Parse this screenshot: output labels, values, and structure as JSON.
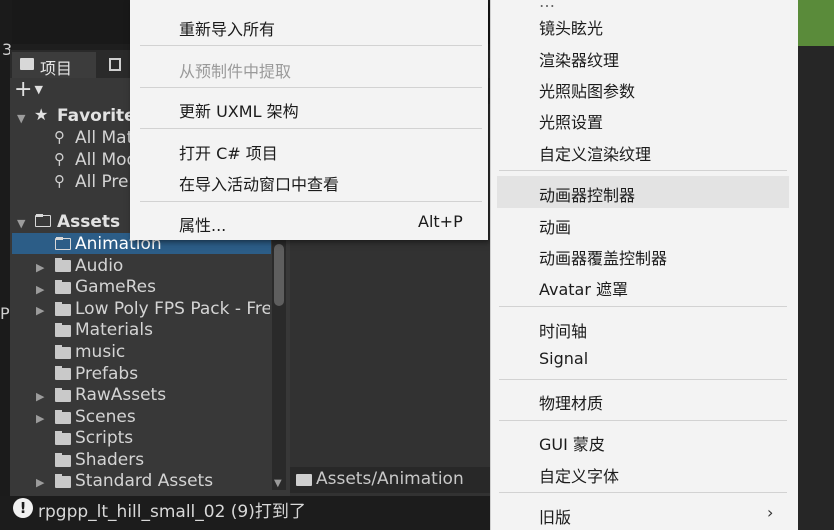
{
  "edge": {
    "num_top": "3",
    "num_mid": "P"
  },
  "project_panel": {
    "tab_label": "项目",
    "add_label": "+",
    "favorites": {
      "label": "Favorites",
      "items": [
        "All Mat",
        "All Mod",
        "All Pre"
      ]
    },
    "assets": {
      "label": "Assets",
      "folders": [
        "Animation",
        "Audio",
        "GameRes",
        "Low Poly FPS Pack - Free",
        "Materials",
        "music",
        "Prefabs",
        "RawAssets",
        "Scenes",
        "Scripts",
        "Shaders",
        "Standard Assets"
      ],
      "selected": "Animation"
    },
    "path": "Assets/Animation"
  },
  "status": {
    "message": "rpgpp_lt_hill_small_02 (9)打到了"
  },
  "context_menu": {
    "items": [
      {
        "label": "重新导入所有",
        "enabled": true
      },
      {
        "label": "从预制件中提取",
        "enabled": false
      },
      {
        "label": "更新 UXML 架构",
        "enabled": true
      },
      {
        "label": "打开 C# 项目",
        "enabled": true
      },
      {
        "label": "在导入活动窗口中查看",
        "enabled": true
      },
      {
        "label": "属性...",
        "shortcut": "Alt+P",
        "enabled": true
      }
    ]
  },
  "create_submenu": {
    "items": [
      "镜头眩光",
      "渲染器纹理",
      "光照贴图参数",
      "光照设置",
      "自定义渲染纹理",
      "动画器控制器",
      "动画",
      "动画器覆盖控制器",
      "Avatar 遮罩",
      "时间轴",
      "Signal",
      "物理材质",
      "GUI 蒙皮",
      "自定义字体",
      "旧版"
    ],
    "hovered": "动画器控制器",
    "legacy_arrow": "›"
  },
  "colors": {
    "selection": "#2c5d87",
    "menu_bg": "#f3f3f3",
    "menu_hover": "#e3e3e3",
    "panel_bg": "#383838"
  }
}
